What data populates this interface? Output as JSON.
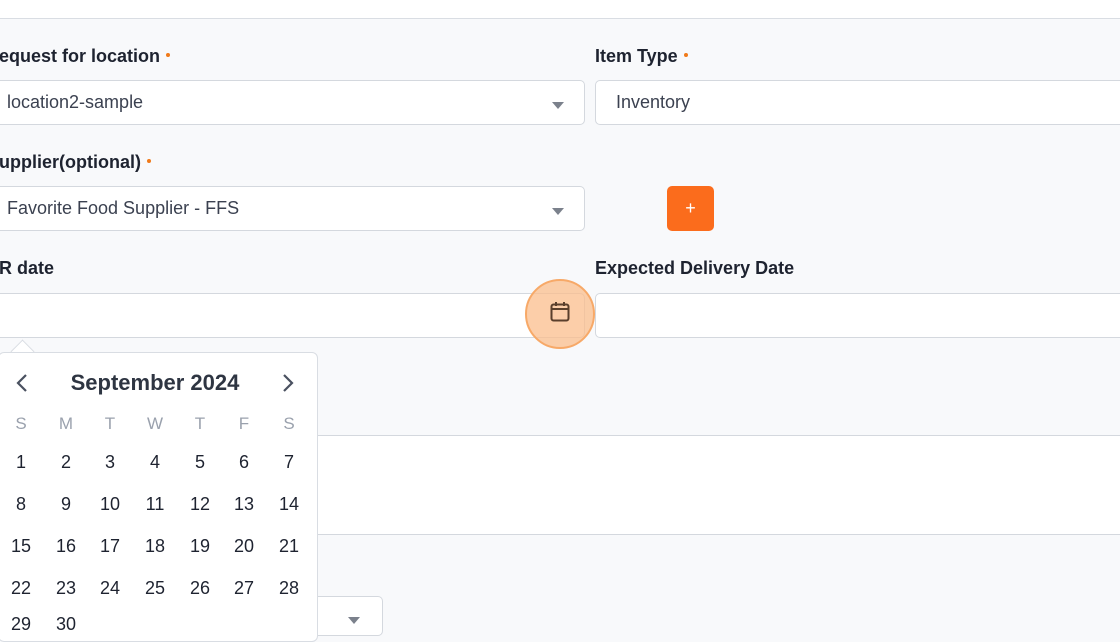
{
  "form": {
    "location_label": "equest for location",
    "location_value": "location2-sample",
    "item_type_label": "Item Type",
    "item_type_value": "Inventory",
    "supplier_label": "upplier(optional)",
    "supplier_value": "Favorite Food Supplier - FFS",
    "add_button_label": "+",
    "pr_date_label": "R date",
    "pr_date_value": "",
    "delivery_label": "Expected Delivery Date",
    "delivery_value": ""
  },
  "calendar": {
    "title": "September 2024",
    "weekdays": [
      "S",
      "M",
      "T",
      "W",
      "T",
      "F",
      "S"
    ],
    "weeks": [
      [
        "1",
        "2",
        "3",
        "4",
        "5",
        "6",
        "7"
      ],
      [
        "8",
        "9",
        "10",
        "11",
        "12",
        "13",
        "14"
      ],
      [
        "15",
        "16",
        "17",
        "18",
        "19",
        "20",
        "21"
      ],
      [
        "22",
        "23",
        "24",
        "25",
        "26",
        "27",
        "28"
      ],
      [
        "29",
        "30"
      ]
    ]
  },
  "colors": {
    "accent": "#fb6c1c",
    "required_dot": "#f07a1a",
    "highlight": "#fbbe8c"
  },
  "icons": {
    "calendar": "calendar-icon",
    "prev": "chevron-left-icon",
    "next": "chevron-right-icon",
    "dropdown": "caret-down-icon"
  }
}
